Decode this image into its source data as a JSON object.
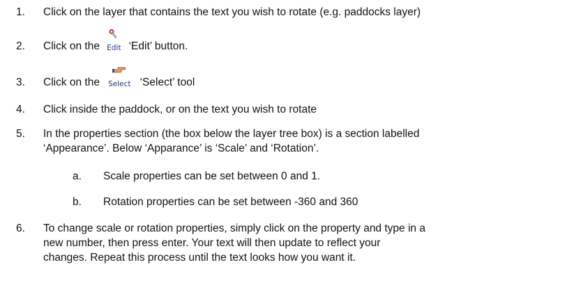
{
  "steps": [
    {
      "num": "1.",
      "text": "Click on the layer that contains the text you wish to rotate (e.g. paddocks layer)"
    },
    {
      "num": "2.",
      "pre": "Click on the ",
      "tool_label": "Edit",
      "tool_icon": "wrench-icon",
      "post": " ‘Edit’ button."
    },
    {
      "num": "3.",
      "pre": "Click on the ",
      "tool_label": "Select",
      "tool_icon": "pointing-hand-icon",
      "post": " ‘Select’ tool"
    },
    {
      "num": "4.",
      "text": "Click inside the paddock, or on the text you wish to rotate"
    },
    {
      "num": "5.",
      "text": "In the properties section (the box below the layer tree box) is a section labelled\n‘Appearance’. Below ‘Apparance’ is ‘Scale’ and ‘Rotation’."
    },
    {
      "num": "a.",
      "text": "Scale properties can be set between 0 and 1."
    },
    {
      "num": "b.",
      "text": "Rotation properties can be set between -360 and 360"
    },
    {
      "num": "6.",
      "text": "To change scale or rotation properties, simply click on the property and type in a\nnew number, then press enter. Your text will then update to reflect your\nchanges.  Repeat this process until the text looks how you want it."
    }
  ]
}
